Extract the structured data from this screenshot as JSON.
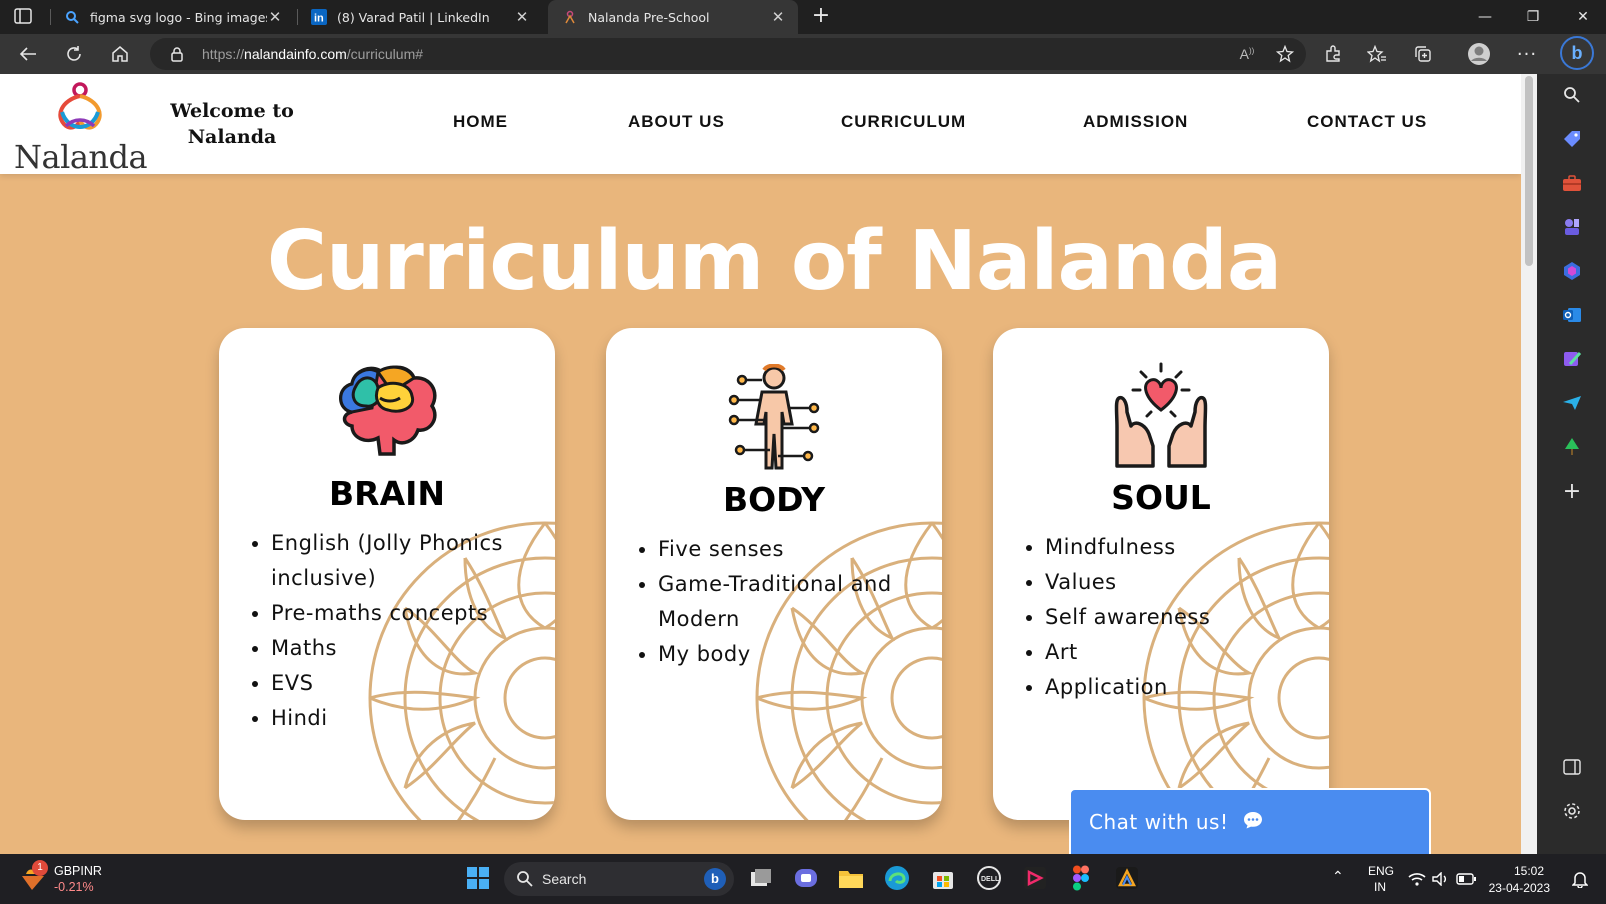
{
  "browser": {
    "tabs": [
      {
        "title": "figma svg logo - Bing images",
        "favicon": "bing-search-icon",
        "active": false
      },
      {
        "title": "(8) Varad Patil | LinkedIn",
        "favicon": "linkedin-icon",
        "active": false
      },
      {
        "title": "Nalanda Pre-School",
        "favicon": "nalanda-favicon",
        "active": true
      }
    ],
    "new_tab": "+",
    "url_prefix": "https://",
    "url_domain": "nalandainfo.com",
    "url_path": "/curriculum#",
    "bing_label": "b"
  },
  "site": {
    "logo_text": "Nalanda",
    "welcome_line1": "Welcome to",
    "welcome_line2": "Nalanda",
    "menu": [
      "HOME",
      "ABOUT US",
      "CURRICULUM",
      "ADMISSION",
      "CONTACT US"
    ],
    "title": "Curriculum of Nalanda",
    "cards": [
      {
        "heading": "BRAIN",
        "icon": "brain-icon",
        "items": [
          "English (Jolly Phonics inclusive)",
          "Pre-maths concepts",
          "Maths",
          "EVS",
          "Hindi"
        ]
      },
      {
        "heading": "BODY",
        "icon": "body-icon",
        "items": [
          "Five senses",
          "Game-Traditional and Modern",
          "My body"
        ]
      },
      {
        "heading": "SOUL",
        "icon": "heart-hands-icon",
        "items": [
          "Mindfulness",
          "Values",
          "Self awareness",
          "Art",
          "Application"
        ]
      }
    ],
    "chat_label": "Chat with us!"
  },
  "taskbar": {
    "stock_name": "GBPINR",
    "stock_change": "-0.21%",
    "stock_badge": "1",
    "search_label": "Search",
    "lang_line1": "ENG",
    "lang_line2": "IN",
    "time": "15:02",
    "date": "23-04-2023"
  },
  "colors": {
    "page_bg": "#e9b67c",
    "chat_blue": "#4a8cf0",
    "mandala": "#d9b07c"
  }
}
